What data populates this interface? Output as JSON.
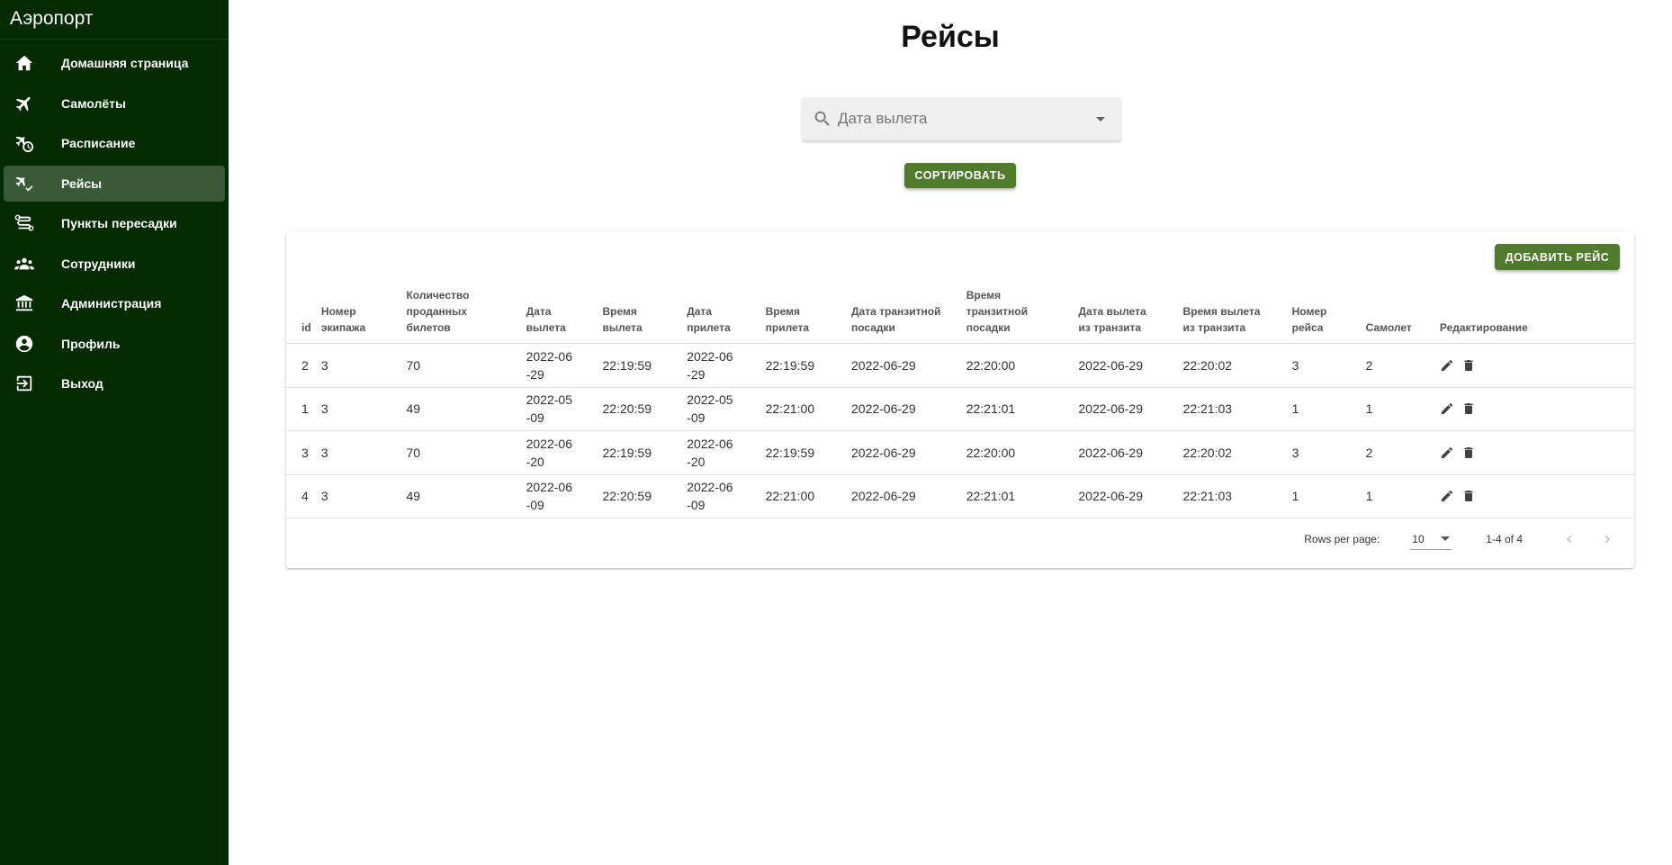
{
  "app": {
    "title": "Аэропорт"
  },
  "sidebar": {
    "items": [
      {
        "label": "Домашняя страница",
        "icon": "home-icon",
        "active": false
      },
      {
        "label": "Самолёты",
        "icon": "airplane-icon",
        "active": false
      },
      {
        "label": "Расписание",
        "icon": "airplane-clock-icon",
        "active": false
      },
      {
        "label": "Рейсы",
        "icon": "airplane-check-icon",
        "active": true
      },
      {
        "label": "Пункты пересадки",
        "icon": "route-icon",
        "active": false
      },
      {
        "label": "Сотрудники",
        "icon": "people-icon",
        "active": false
      },
      {
        "label": "Администрация",
        "icon": "bank-icon",
        "active": false
      },
      {
        "label": "Профиль",
        "icon": "account-circle-icon",
        "active": false
      },
      {
        "label": "Выход",
        "icon": "logout-icon",
        "active": false
      }
    ]
  },
  "main": {
    "title": "Рейсы",
    "search": {
      "placeholder": "Дата вылета"
    },
    "sort_label": "СОРТИРОВАТЬ",
    "add_label": "ДОБАВИТЬ РЕЙС"
  },
  "table": {
    "columns": [
      "id",
      "Номер экипажа",
      "Количество проданных билетов",
      "Дата вылета",
      "Время вылета",
      "Дата прилета",
      "Время прилета",
      "Дата транзитной посадки",
      "Время транзитной посадки",
      "Дата вылета из транзита",
      "Время вылета из транзита",
      "Номер рейса",
      "Самолет",
      "Редактирование"
    ],
    "rows": [
      [
        "2",
        "3",
        "70",
        "2022-06-29",
        "22:19:59",
        "2022-06-29",
        "22:19:59",
        "2022-06-29",
        "22:20:00",
        "2022-06-29",
        "22:20:02",
        "3",
        "2"
      ],
      [
        "1",
        "3",
        "49",
        "2022-05-09",
        "22:20:59",
        "2022-05-09",
        "22:21:00",
        "2022-06-29",
        "22:21:01",
        "2022-06-29",
        "22:21:03",
        "1",
        "1"
      ],
      [
        "3",
        "3",
        "70",
        "2022-06-20",
        "22:19:59",
        "2022-06-20",
        "22:19:59",
        "2022-06-29",
        "22:20:00",
        "2022-06-29",
        "22:20:02",
        "3",
        "2"
      ],
      [
        "4",
        "3",
        "49",
        "2022-06-09",
        "22:20:59",
        "2022-06-09",
        "22:21:00",
        "2022-06-29",
        "22:21:01",
        "2022-06-29",
        "22:21:03",
        "1",
        "1"
      ]
    ]
  },
  "pagination": {
    "rows_per_page_label": "Rows per page:",
    "rows_per_page": "10",
    "range": "1-4 of 4"
  },
  "colors": {
    "sidebar_bg": "#032a00",
    "active_item": "#3a5a37",
    "button": "#4f7a2c"
  }
}
